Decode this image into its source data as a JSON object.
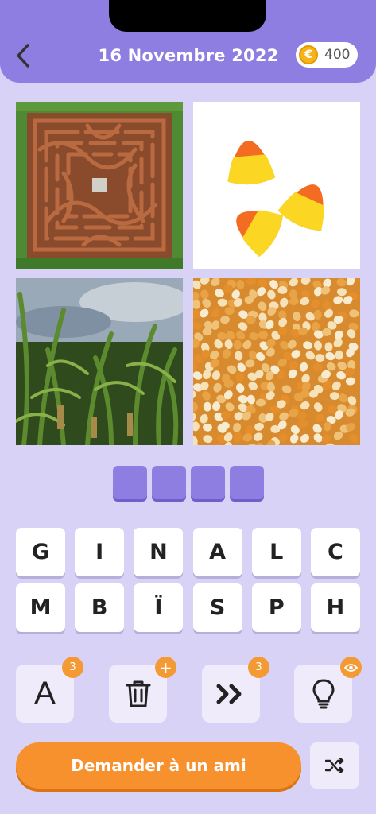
{
  "header": {
    "title": "16 Novembre 2022",
    "coins": "400",
    "coin_symbol": "€",
    "back_icon": "chevron-left-icon"
  },
  "images": [
    {
      "name": "maze-photo",
      "desc_icon": "corn-maze-aerial"
    },
    {
      "name": "candy-corn-photo",
      "desc_icon": "candy-corn"
    },
    {
      "name": "cornfield-photo",
      "desc_icon": "cornfield"
    },
    {
      "name": "corn-kernels-photo",
      "desc_icon": "popcorn-kernels"
    }
  ],
  "answer_slots": 4,
  "keyboard": {
    "row1": [
      "G",
      "I",
      "N",
      "A",
      "L",
      "C"
    ],
    "row2": [
      "M",
      "B",
      "Ï",
      "S",
      "P",
      "H"
    ]
  },
  "helpers": [
    {
      "name": "reveal-letter",
      "glyph": "A",
      "badge": "3"
    },
    {
      "name": "remove-letters",
      "icon": "trash-icon",
      "badge": "+"
    },
    {
      "name": "skip-level",
      "icon": "double-chevron-icon",
      "badge": "3"
    },
    {
      "name": "hint",
      "icon": "lightbulb-icon",
      "badge_icon": "eye-icon"
    }
  ],
  "actions": {
    "ask_friend": "Demander à un ami",
    "shuffle_icon": "shuffle-icon"
  },
  "colors": {
    "background": "#d9d2f7",
    "header": "#8f7ee2",
    "accent": "#f7912e",
    "slot": "#8f7ee2"
  }
}
